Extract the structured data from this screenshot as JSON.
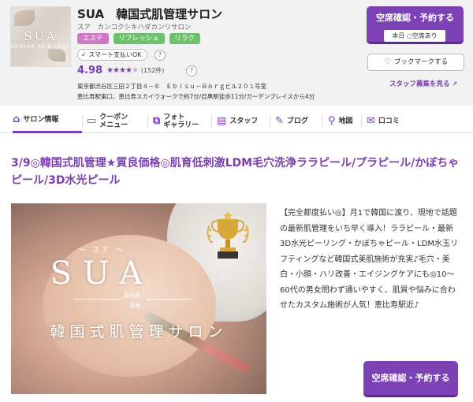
{
  "salon": {
    "name": "SUA　韓国式肌管理サロン",
    "kana": "スア　カンコクシキハダカンリサロン",
    "logo_text": "SUA",
    "logo_sub": "KOREAN SKIN CARE",
    "tags": [
      "エステ",
      "リフレッシュ",
      "リラク"
    ],
    "smart_pay": "スマート支払いOK",
    "rating": "4.98",
    "stars": "★★★★",
    "half_star": "★",
    "review_count": "(152件)",
    "address": "東京都渋谷区三田２丁目４－６　Ｅｂｉｓｕ－Ｂｏｒｇビル２０１号室",
    "access": "恵比寿駅東口、恵比寿スカイウォークで約7分/目黒駅徒歩11分/ガーデンプレイスから4分"
  },
  "actions": {
    "reserve_label": "空席確認・予約する",
    "availability": "本日",
    "availability_mark": "○",
    "availability_status": "空席あり",
    "bookmark_label": "ブックマークする",
    "staff_recruit": "スタッフ募集を見る",
    "help_mark": "?"
  },
  "nav": {
    "tabs": [
      {
        "label": "サロン情報",
        "icon": "house-icon"
      },
      {
        "label_top": "クーポン",
        "label_bottom": "メニュー",
        "icon": "ticket-icon"
      },
      {
        "label_top": "フォト",
        "label_bottom": "ギャラリー",
        "icon": "photo-icon"
      },
      {
        "label": "スタッフ",
        "icon": "staff-card-icon"
      },
      {
        "label": "ブログ",
        "icon": "pencil-icon"
      },
      {
        "label": "地図",
        "icon": "map-pin-icon"
      },
      {
        "label": "口コミ",
        "icon": "speech-bubble-icon"
      }
    ]
  },
  "main": {
    "headline": "3/9◎韓国式肌管理★質良価格◎肌育低刺激LDM毛穴洗浄ララピール/プラピール/かぼちゃピール/3D水光ピール",
    "photo": {
      "kana": "～ スア ～",
      "brand": "SUA",
      "loc1": "恵比寿",
      "loc2": "目黒",
      "catch": "韓国式肌管理サロン"
    },
    "description": "【完全都度払い◎】月1で韓国に渡り、現地で話題の最新肌管理をいち早く導入！ララピール・最新3D水光ピーリング・かぼちゃピール・LDM水玉リフティングなど韓国式美肌施術が充実♪毛穴・美白・小顔・ハリ改善・エイジングケアにも◎10～60代の男女問わず通いやすく、肌質や悩みに合わせたカスタム施術が人気！恵比寿駅近♪",
    "reserve_label": "空席確認・予約する"
  },
  "colors": {
    "accent": "#7b41b5",
    "tag_pink": "#d178c4",
    "tag_green": "#6fc06c"
  }
}
